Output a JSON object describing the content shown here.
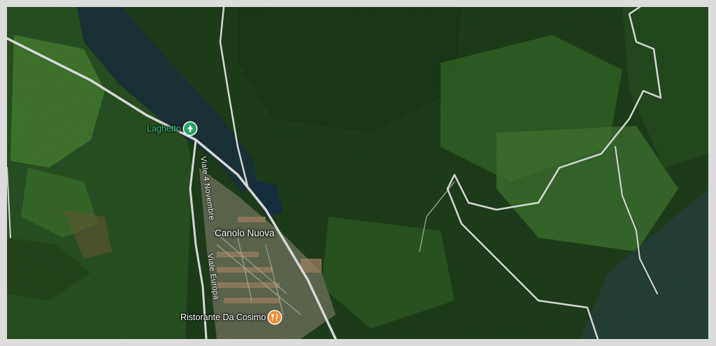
{
  "map": {
    "type": "satellite",
    "colors": {
      "forest_dark": "#23361f",
      "forest_mid": "#2f4a26",
      "meadow": "#4f7d36",
      "lake": "#1d2c3e",
      "road": "#d7d7d7",
      "poi_park": "#27a268",
      "poi_food": "#f28b32",
      "park_label": "#3cc98a",
      "food_label": "#ffffff"
    },
    "pois": [
      {
        "label": "Laghetto",
        "category": "park",
        "icon": "tree-icon"
      },
      {
        "label": "Ristorante Da Cosimo",
        "category": "restaurant",
        "icon": "fork-knife-icon"
      }
    ],
    "places": [
      {
        "label": "Canolo Nuova"
      }
    ],
    "streets": [
      {
        "label": "Viale 4 Novembre"
      },
      {
        "label": "Viale Europa"
      }
    ]
  }
}
